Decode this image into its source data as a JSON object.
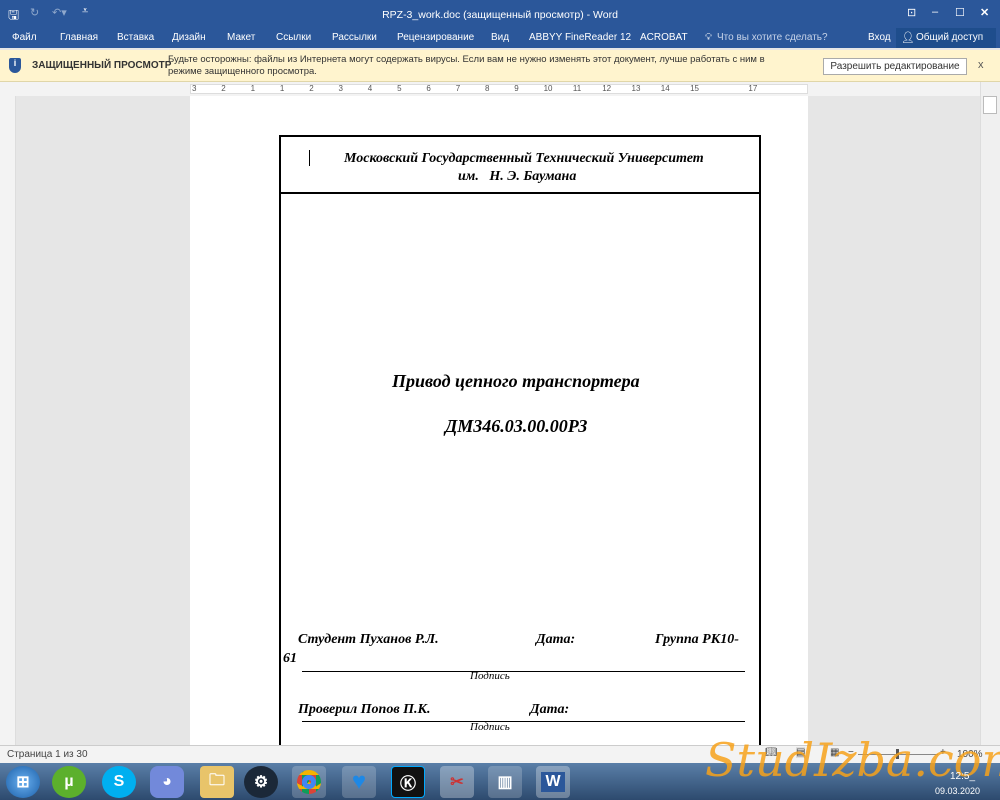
{
  "window": {
    "title": "RPZ-3_work.doc (защищенный просмотр) - Word",
    "controls": {
      "ribbon_display": "⊡",
      "minimize": "–",
      "maximize": "☐",
      "close": "✕"
    }
  },
  "ribbon": {
    "tabs": [
      "Файл",
      "Главная",
      "Вставка",
      "Дизайн",
      "Макет",
      "Ссылки",
      "Рассылки",
      "Рецензирование",
      "Вид",
      "ABBYY FineReader 12",
      "ACROBAT"
    ],
    "tell_me": "Что вы хотите сделать?",
    "sign_in": "Вход",
    "share": "Общий доступ"
  },
  "protected_view": {
    "label": "ЗАЩИЩЕННЫЙ ПРОСМОТР",
    "message": "Будьте осторожны: файлы из Интернета могут содержать вирусы. Если вам не нужно изменять этот документ, лучше работать с ним в режиме защищенного просмотра.",
    "enable_button": "Разрешить редактирование",
    "close": "x"
  },
  "ruler": {
    "ticks": [
      "3",
      "2",
      "1",
      "1",
      "2",
      "3",
      "4",
      "5",
      "6",
      "7",
      "8",
      "9",
      "10",
      "11",
      "12",
      "13",
      "14",
      "15",
      "17"
    ]
  },
  "document": {
    "university": "Московский Государственный Технический Университет",
    "university2": "им.   Н. Э. Баумана",
    "title": "Привод цепного транспортера",
    "code": "ДМ346.03.00.00РЗ",
    "student": "Студент Пуханов Р.Л.",
    "date1": "Дата:",
    "group": "Группа РК10-",
    "group2": "61",
    "signature1": "Подпись",
    "checked": "Проверил Попов П.К.",
    "date2": "Дата:",
    "signature2": "Подпись"
  },
  "status": {
    "page": "Страница 1 из 30",
    "zoom": "100%"
  },
  "taskbar": {
    "clock": "12:5_",
    "date": "09.03.2020",
    "watermark": "StudIzba.com"
  }
}
